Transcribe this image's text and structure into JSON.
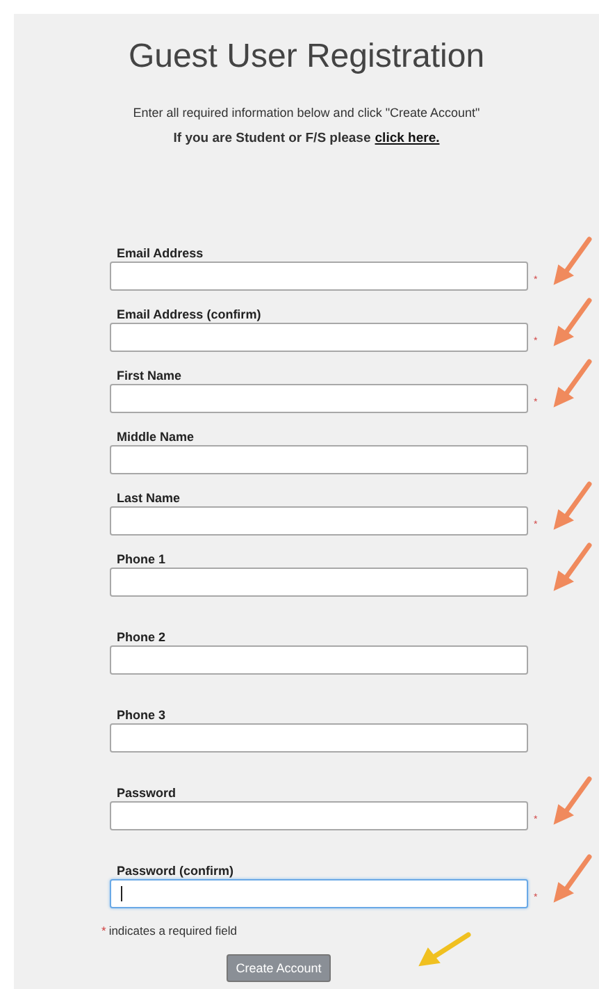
{
  "title": "Guest User Registration",
  "intro": "Enter all required information below and click \"Create Account\"",
  "student_note": {
    "text": "If you are Student or F/S please",
    "link": "click here."
  },
  "sections": [
    {
      "fields": [
        {
          "label": "Email Address",
          "required": true,
          "focused": false,
          "arrow": true
        },
        {
          "label": "Email Address (confirm)",
          "required": true,
          "focused": false,
          "arrow": true
        },
        {
          "label": "First Name",
          "required": true,
          "focused": false,
          "arrow": true
        },
        {
          "label": "Middle Name",
          "required": false,
          "focused": false,
          "arrow": false
        },
        {
          "label": "Last Name",
          "required": true,
          "focused": false,
          "arrow": true
        },
        {
          "label": "Phone 1",
          "required": false,
          "focused": false,
          "arrow": true
        }
      ]
    },
    {
      "fields": [
        {
          "label": "Phone 2",
          "required": false,
          "focused": false,
          "arrow": false
        }
      ]
    },
    {
      "fields": [
        {
          "label": "Phone 3",
          "required": false,
          "focused": false,
          "arrow": false
        }
      ]
    },
    {
      "fields": [
        {
          "label": "Password",
          "required": true,
          "focused": false,
          "arrow": true
        }
      ]
    },
    {
      "fields": [
        {
          "label": "Password (confirm)",
          "required": true,
          "focused": true,
          "arrow": true
        }
      ]
    }
  ],
  "required_note": {
    "mark": "*",
    "text": "indicates a required field"
  },
  "submit": {
    "label": "Create Account",
    "arrow": true
  }
}
